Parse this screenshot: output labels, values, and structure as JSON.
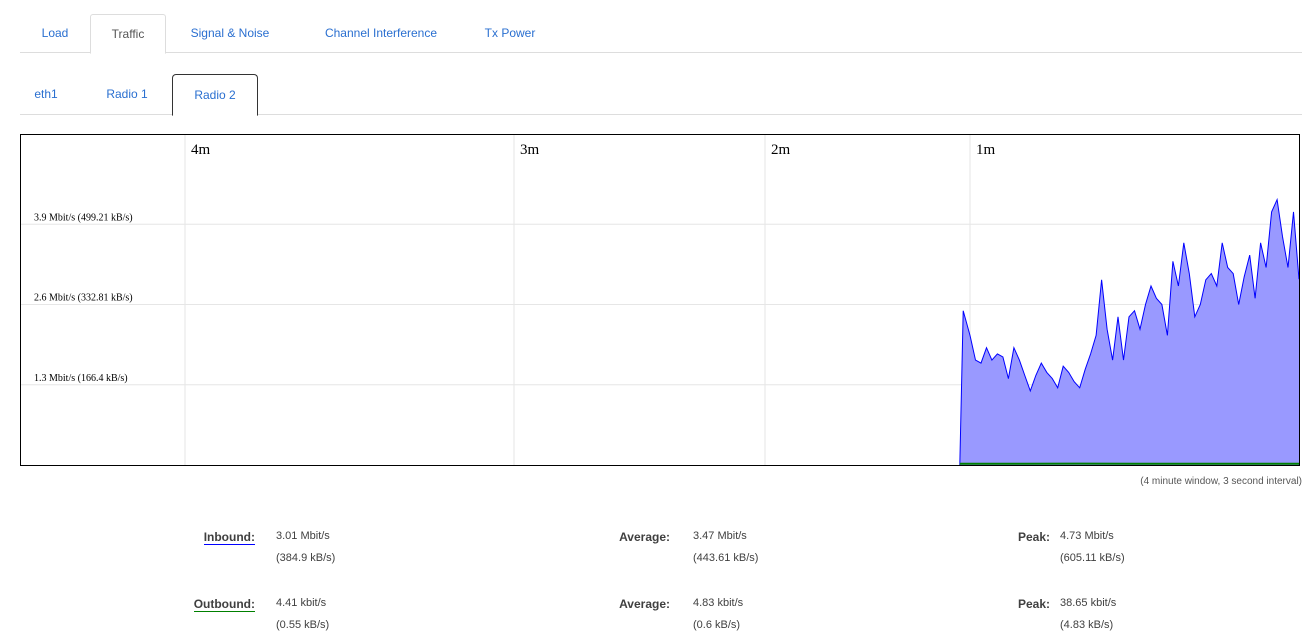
{
  "tabs": [
    {
      "label": "Load",
      "active": false
    },
    {
      "label": "Traffic",
      "active": true
    },
    {
      "label": "Signal & Noise",
      "active": false
    },
    {
      "label": "Channel Interference",
      "active": false
    },
    {
      "label": "Tx Power",
      "active": false
    }
  ],
  "subtabs": [
    {
      "label": "eth1",
      "active": false
    },
    {
      "label": "Radio 1",
      "active": false
    },
    {
      "label": "Radio 2",
      "active": true
    }
  ],
  "caption": "(4 minute window, 3 second interval)",
  "colors": {
    "inbound_fill": "#9999ff",
    "inbound_line": "#0000ff",
    "outbound_line": "#008000",
    "link": "#2a6fd0"
  },
  "stats": {
    "inbound": {
      "label": "Inbound:",
      "current": "3.01 Mbit/s",
      "current_kb": "(384.9 kB/s)",
      "avg_label": "Average:",
      "average": "3.47 Mbit/s",
      "average_kb": "(443.61 kB/s)",
      "peak_label": "Peak:",
      "peak": "4.73 Mbit/s",
      "peak_kb": "(605.11 kB/s)"
    },
    "outbound": {
      "label": "Outbound:",
      "current": "4.41 kbit/s",
      "current_kb": "(0.55 kB/s)",
      "avg_label": "Average:",
      "average": "4.83 kbit/s",
      "average_kb": "(0.6 kB/s)",
      "peak_label": "Peak:",
      "peak": "38.65 kbit/s",
      "peak_kb": "(4.83 kB/s)"
    }
  },
  "chart_data": {
    "type": "area",
    "x_ticks": [
      "4m",
      "3m",
      "2m",
      "1m"
    ],
    "y_ticks": [
      "3.9 Mbit/s (499.21 kB/s)",
      "2.6 Mbit/s (332.81 kB/s)",
      "1.3 Mbit/s (166.4 kB/s)"
    ],
    "y_tick_values": [
      3.9,
      2.6,
      1.3
    ],
    "ylim": [
      0,
      5.2
    ],
    "xlim": [
      240,
      0
    ],
    "x_tick_values": [
      240,
      180,
      120,
      60
    ],
    "series": [
      {
        "name": "Inbound",
        "x": [
          63,
          62,
          61,
          60,
          59,
          58,
          57,
          56,
          55,
          54,
          53,
          52,
          51,
          50,
          49,
          48,
          47,
          46,
          45,
          44,
          43,
          42,
          41,
          40,
          39,
          38,
          37,
          36,
          35,
          34,
          33,
          32,
          31,
          30,
          29,
          28,
          27,
          26,
          25,
          24,
          23,
          22,
          21,
          20,
          19,
          18,
          17,
          16,
          15,
          14,
          13,
          12,
          11,
          10,
          9,
          8,
          7,
          6,
          5,
          4,
          3,
          2,
          1,
          0
        ],
        "values": [
          0,
          2.5,
          2.3,
          2.1,
          1.7,
          1.65,
          1.9,
          1.7,
          1.8,
          1.75,
          1.4,
          1.9,
          1.7,
          1.45,
          1.2,
          1.45,
          1.65,
          1.5,
          1.4,
          1.25,
          1.6,
          1.5,
          1.35,
          1.25,
          1.55,
          1.8,
          2.1,
          3.0,
          2.2,
          1.7,
          2.4,
          1.7,
          2.4,
          2.5,
          2.2,
          2.6,
          2.9,
          2.7,
          2.6,
          2.1,
          3.3,
          2.9,
          3.6,
          3.1,
          2.4,
          2.6,
          3.0,
          3.1,
          2.9,
          3.6,
          3.2,
          3.1,
          2.6,
          3.05,
          3.4,
          2.7,
          3.6,
          3.2,
          4.1,
          4.3,
          3.7,
          3.2,
          4.1,
          3.01
        ],
        "color": "#0000ff"
      },
      {
        "name": "Outbound",
        "x": [
          63,
          60,
          50,
          40,
          30,
          20,
          10,
          0
        ],
        "values": [
          0.004,
          0.004,
          0.005,
          0.006,
          0.004,
          0.005,
          0.005,
          0.004
        ],
        "color": "#008000"
      }
    ]
  }
}
